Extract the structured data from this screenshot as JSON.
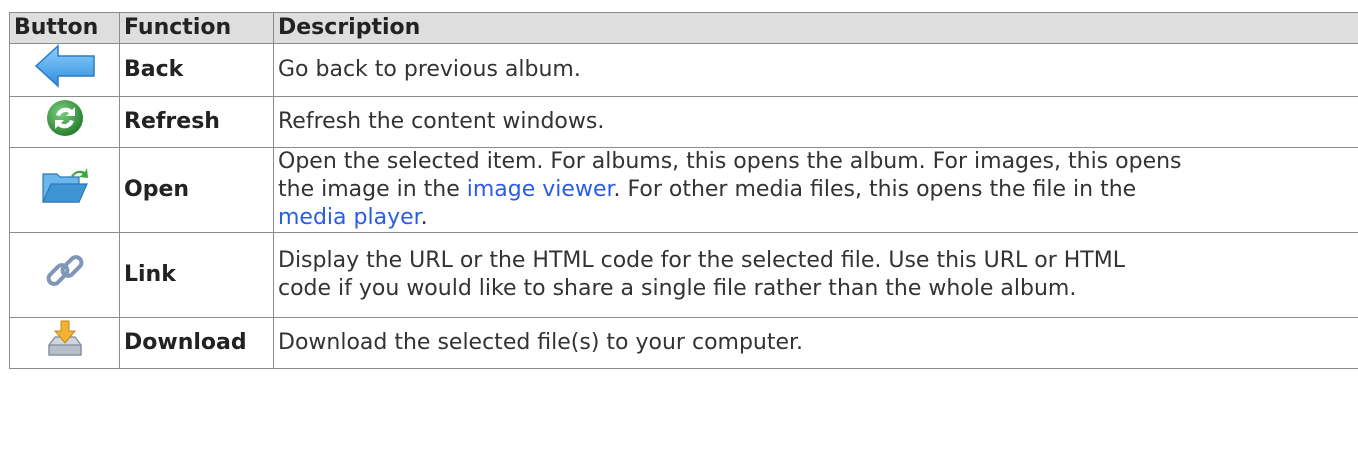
{
  "table": {
    "headers": {
      "button": "Button",
      "function": "Function",
      "description": "Description"
    },
    "rows": [
      {
        "icon": "back-arrow-icon",
        "function": "Back",
        "description": "Go back to previous album."
      },
      {
        "icon": "refresh-icon",
        "function": "Refresh",
        "description": "Refresh the content windows."
      },
      {
        "icon": "open-folder-icon",
        "function": "Open",
        "description_part1": "Open the selected item. For albums, this opens the album. For images, this opens",
        "description_part2": "the image in the ",
        "link1": "image viewer",
        "description_part3": ". For other media files, this opens the file in the",
        "link2": "media player",
        "description_part4": "."
      },
      {
        "icon": "link-chain-icon",
        "function": "Link",
        "description_line1": "Display the URL or the HTML code for the selected file. Use this URL or HTML",
        "description_line2": "code if you would like to share a single file rather than the whole album."
      },
      {
        "icon": "download-icon",
        "function": "Download",
        "description": "Download the selected file(s) to your computer."
      }
    ]
  },
  "colors": {
    "header_bg": "#dedede",
    "border": "#8c8c8c",
    "link": "#2b5ce6",
    "back_arrow": "#4fa3e8",
    "refresh": "#3a9a3a",
    "folder": "#4b9fd8"
  }
}
